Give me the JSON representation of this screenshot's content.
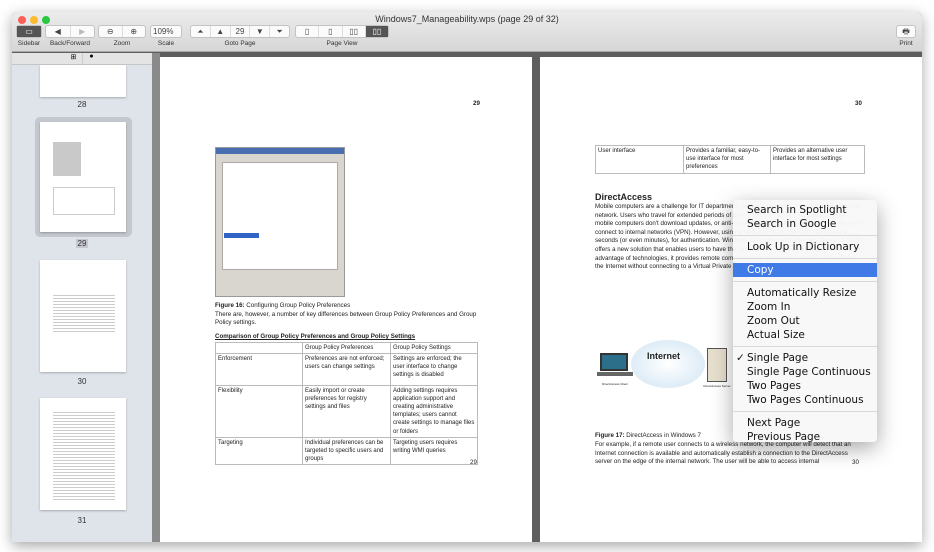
{
  "window": {
    "title": "Windows7_Manageability.wps (page 29 of 32)"
  },
  "toolbar": {
    "sidebar": "Sidebar",
    "back_forward": "Back/Forward",
    "zoom": "Zoom",
    "scale": "Scale",
    "scale_value": "109%",
    "goto_page": "Goto Page",
    "page_value": "29",
    "page_view": "Page View",
    "print": "Print"
  },
  "sidebar": {
    "thumbs": [
      {
        "label": "28"
      },
      {
        "label": "29",
        "selected": true
      },
      {
        "label": "30"
      },
      {
        "label": "31"
      }
    ]
  },
  "page29": {
    "number": "29",
    "figure_caption_bold": "Figure 16:",
    "figure_caption": " Configuring Group Policy Preferences",
    "intro": "There are, however, a number of  key differences between Group Policy Preferences and Group Policy settings.",
    "table_title": "Comparison of Group Policy Preferences and Group Policy Settings",
    "table": {
      "headers": [
        "",
        "Group Policy Preferences",
        "Group Policy Settings"
      ],
      "rows": [
        [
          "Enforcement",
          "Preferences are not enforced; users can change settings",
          "Settings are enforced; the user interface to change settings is disabled"
        ],
        [
          "Flexibility",
          "Easily import or create preferences for registry settings and files",
          "Adding settings requires application support and creating administrative templates; users cannot create settings to manage files or folders"
        ],
        [
          "Targeting",
          "Individual preferences can be targeted to specific users and groups",
          "Targeting users requires writing WMI queries"
        ]
      ]
    },
    "footer": "29"
  },
  "page30": {
    "number": "30",
    "table_row": [
      "User interface",
      "Provides a familiar, easy-to-use interface for most preferences",
      "Provides an alternative user interface for most settings"
    ],
    "heading": "DirectAccess",
    "paragraph": "Mobile computers are a challenge for IT departments because they are connected to the internal network. Users who travel for extended periods of time might not connect. As a result, these mobile computers don't download updates, or anti-malware definitions. Traditionally, remote users connect to internal networks (VPN). However, using a VPN can be cumbersome and several seconds (or even minutes), for authentication. Windows 7, together with Windows Server 2008 R2, offers a new solution that enables users to have the same experience working in the office. Taking advantage of technologies, it provides remote computers with automatic, seamless access over the Internet without connecting to a Virtual Private Network infrastructure for enterprises.",
    "diagram": {
      "cloud_label": "Internet",
      "client_label": "DirectAccess Client",
      "server_label": "DirectAccess Server"
    },
    "figure_caption_bold": "Figure 17:",
    "figure_caption": " DirectAccess in Windows 7",
    "body2": "For example, if a remote user connects to a wireless network, the computer will detect that an Internet connection is available and automatically establish a connection to the DirectAccess server on the edge of the internal network. The user will be able to access internal",
    "footer": "30"
  },
  "context_menu": {
    "items": [
      "Search in Spotlight",
      "Search in Google",
      "Look Up in Dictionary",
      "Copy",
      "Automatically Resize",
      "Zoom In",
      "Zoom Out",
      "Actual Size",
      "Single Page",
      "Single Page Continuous",
      "Two Pages",
      "Two Pages Continuous",
      "Next Page",
      "Previous Page"
    ],
    "highlighted": "Copy",
    "checked": "Single Page",
    "highlight_color": "#3f7ae6"
  }
}
